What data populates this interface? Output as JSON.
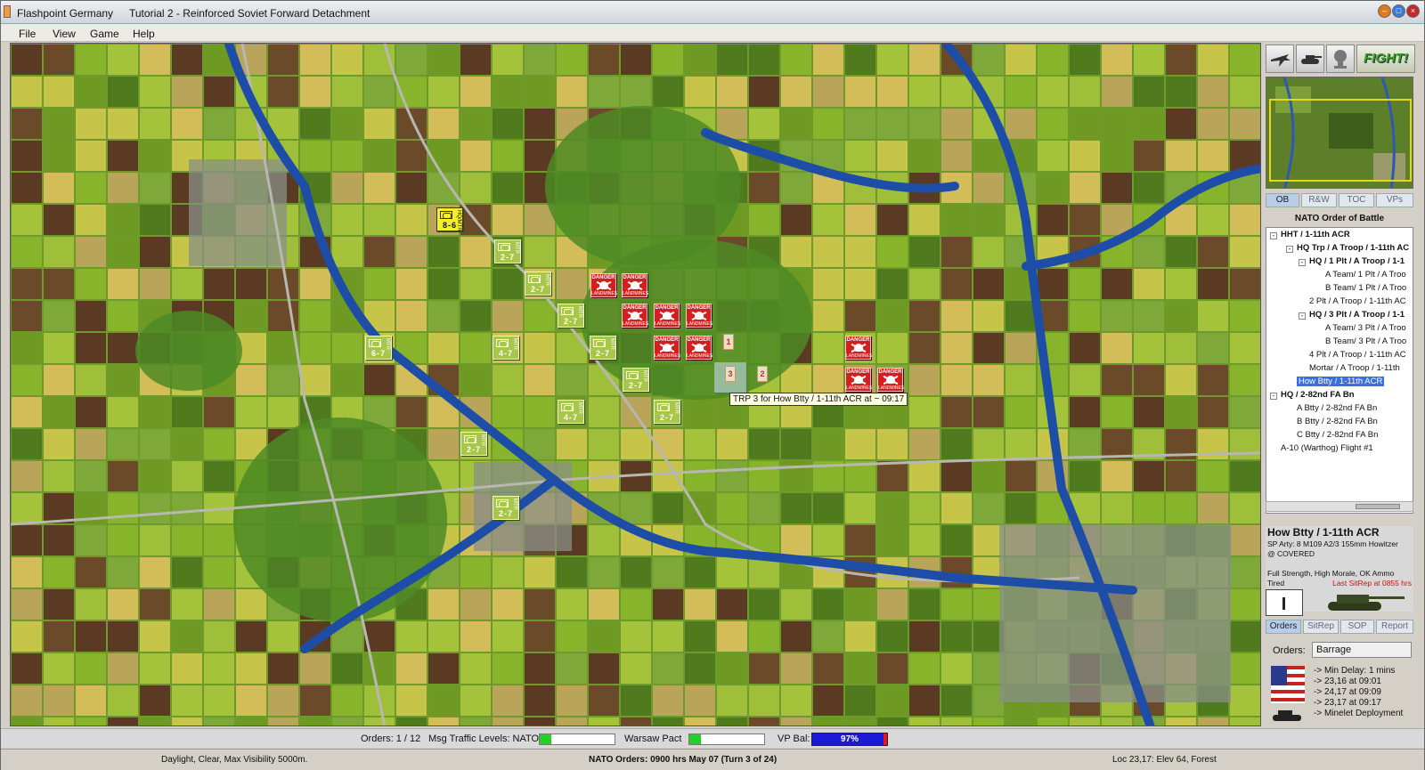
{
  "window": {
    "app_title": "Flashpoint Germany",
    "doc_title": "Tutorial 2 - Reinforced Soviet Forward Detachment"
  },
  "menu": [
    "File",
    "View",
    "Game",
    "Help"
  ],
  "map": {
    "counters": [
      {
        "text": "8-6",
        "size": "HQ/MTR",
        "selected": true
      },
      {
        "text": "2-7",
        "size": "MTR"
      },
      {
        "text": "2-7",
        "size": "MTR"
      },
      {
        "text": "2-7",
        "size": "MTR"
      },
      {
        "text": "4-7",
        "size": "MTR"
      },
      {
        "text": "2-7",
        "size": "MTR"
      },
      {
        "text": "6-7",
        "size": "MTR"
      },
      {
        "text": "2-7",
        "size": "MTR"
      },
      {
        "text": "4-7",
        "size": "MTR"
      },
      {
        "text": "2-7",
        "size": "MTR"
      },
      {
        "text": "2-7",
        "size": "MTR"
      },
      {
        "text": "2-7",
        "size": "MTR"
      }
    ],
    "minefield_label_top": "DANGER",
    "minefield_label_bottom": "LANDMINES",
    "trp_markers": [
      "1",
      "3",
      "2"
    ],
    "tooltip": "TRP 3 for How Btty / 1-11th ACR at ~ 09:17"
  },
  "sidebar": {
    "fight_label": "FIGHT!",
    "toolbar_icons": [
      "aircraft-icon",
      "tank-icon",
      "explosion-icon"
    ],
    "tabs": [
      "OB",
      "R&W",
      "TOC",
      "VPs"
    ],
    "oob_title": "NATO Order of Battle",
    "oob": [
      {
        "label": "HHT / 1-11th ACR",
        "bold": true,
        "exp": "-"
      },
      {
        "label": "HQ Trp / A Troop / 1-11th AC",
        "bold": true,
        "exp": "-"
      },
      {
        "label": "HQ / 1 Plt / A Troop / 1-1",
        "bold": true,
        "exp": "-"
      },
      {
        "label": "A Team/ 1 Plt / A Troo"
      },
      {
        "label": "B Team/ 1 Plt / A Troo"
      },
      {
        "label": "2 Plt / A Troop / 1-11th AC"
      },
      {
        "label": "HQ / 3 Plt / A Troop / 1-1",
        "bold": true,
        "exp": "-"
      },
      {
        "label": "A Team/ 3 Plt / A Troo"
      },
      {
        "label": "B Team/ 3 Plt / A Troo"
      },
      {
        "label": "4 Plt / A Troop / 1-11th AC"
      },
      {
        "label": "Mortar / A Troop / 1-11th"
      },
      {
        "label": "How Btty / 1-11th ACR",
        "highlight": true
      },
      {
        "label": "HQ / 2-82nd FA Bn",
        "bold": true,
        "exp": "-"
      },
      {
        "label": "A Btty / 2-82nd FA Bn"
      },
      {
        "label": "B Btty / 2-82nd FA Bn"
      },
      {
        "label": "C Btty / 2-82nd FA Bn"
      },
      {
        "label": "A-10 (Warthog) Flight #1"
      }
    ],
    "unit": {
      "name": "How Btty / 1-11th ACR",
      "desc": "SP Arty: 8 M109 A2/3 155mm Howitzer",
      "posture": "@ COVERED",
      "status": "Full Strength, High Morale, OK Ammo",
      "fatigue": "Tired",
      "sitrep": "Last SitRep at 0855 hrs"
    },
    "tabs2": [
      "Orders",
      "SitRep",
      "SOP",
      "Report"
    ],
    "orders_label": "Orders:",
    "orders_value": "Barrage",
    "order_items": [
      "-> Min Delay: 1 mins",
      "-> 23,16 at 09:01",
      "-> 24,17 at 09:09",
      "-> 23,17 at 09:17",
      "-> Minelet Deployment"
    ]
  },
  "status": {
    "orders_count": "Orders: 1 / 12",
    "msg_label": "Msg Traffic Levels: NATO",
    "nato_level": 0.15,
    "wp_label": "Warsaw Pact",
    "wp_level": 0.15,
    "vp_label": "VP Bal:",
    "vp_value": "97%"
  },
  "info": {
    "weather": "Daylight, Clear, Max Visibility 5000m.",
    "turn": "NATO Orders: 0900 hrs May 07 (Turn 3 of 24)",
    "location": "Loc 23,17: Elev 64, Forest"
  },
  "colors": {
    "river": "#1e4da8",
    "counter": "#a8c64a",
    "minefield": "#d41f1f",
    "highlight": "#3b6ee0"
  }
}
